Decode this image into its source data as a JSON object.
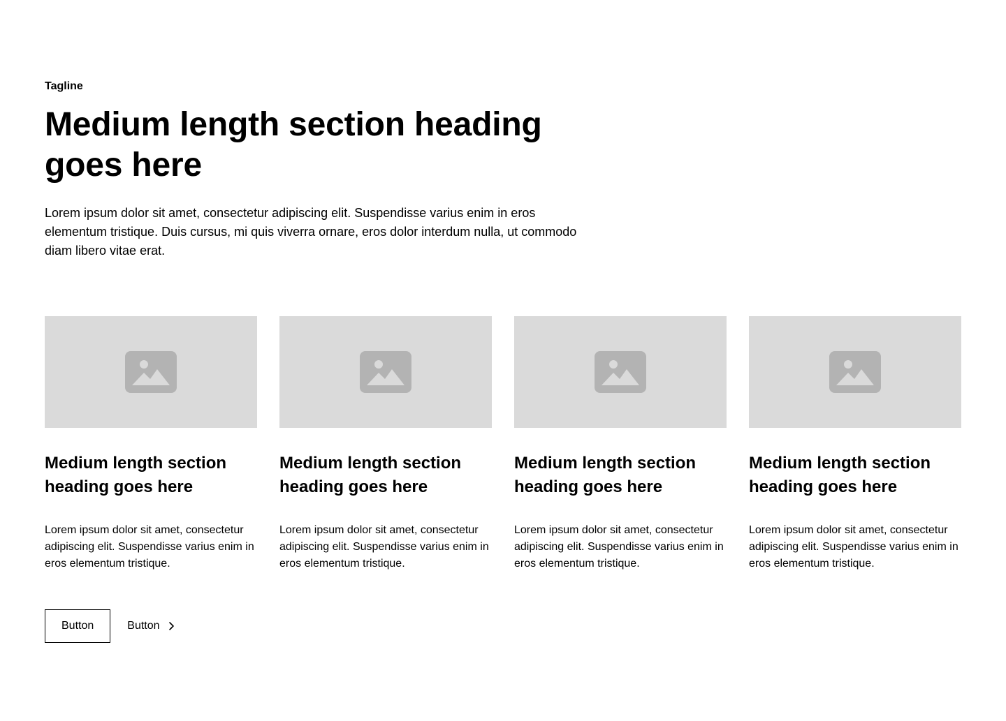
{
  "section": {
    "tagline": "Tagline",
    "heading": "Medium length section heading goes here",
    "intro": "Lorem ipsum dolor sit amet, consectetur adipiscing elit. Suspendisse varius enim in eros elementum tristique. Duis cursus, mi quis viverra ornare, eros dolor interdum nulla, ut commodo diam libero vitae erat."
  },
  "cards": [
    {
      "image_icon": "image-placeholder-icon",
      "heading": "Medium length section heading goes here",
      "text": "Lorem ipsum dolor sit amet, consectetur adipiscing elit. Suspendisse varius enim in eros elementum tristique."
    },
    {
      "image_icon": "image-placeholder-icon",
      "heading": "Medium length section heading goes here",
      "text": "Lorem ipsum dolor sit amet, consectetur adipiscing elit. Suspendisse varius enim in eros elementum tristique."
    },
    {
      "image_icon": "image-placeholder-icon",
      "heading": "Medium length section heading goes here",
      "text": "Lorem ipsum dolor sit amet, consectetur adipiscing elit. Suspendisse varius enim in eros elementum tristique."
    },
    {
      "image_icon": "image-placeholder-icon",
      "heading": "Medium length section heading goes here",
      "text": "Lorem ipsum dolor sit amet, consectetur adipiscing elit. Suspendisse varius enim in eros elementum tristique."
    }
  ],
  "actions": {
    "primary_label": "Button",
    "link_label": "Button",
    "link_icon": "chevron-right-icon"
  },
  "colors": {
    "background": "#ffffff",
    "text": "#000000",
    "placeholder_bg": "#dadada",
    "placeholder_icon": "#b3b3b3"
  }
}
